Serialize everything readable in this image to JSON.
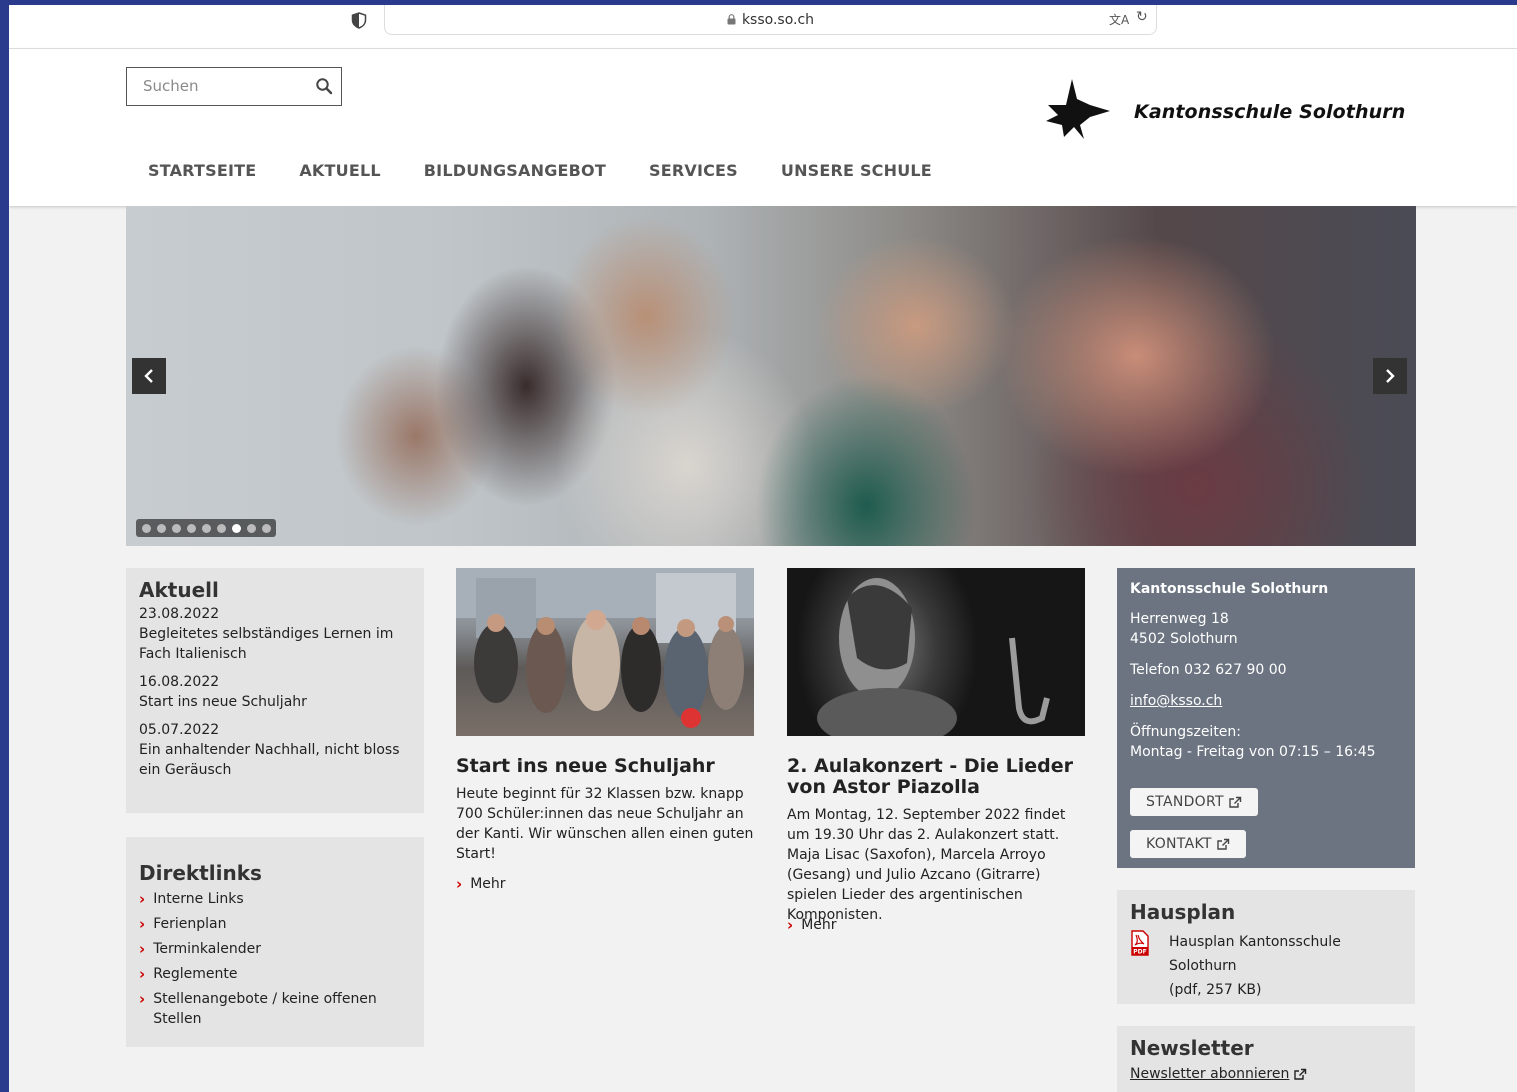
{
  "browser": {
    "url": "ksso.so.ch"
  },
  "header": {
    "search_placeholder": "Suchen",
    "school_name": "Kantonsschule Solothurn",
    "nav": [
      "STARTSEITE",
      "AKTUELL",
      "BILDUNGSANGEBOT",
      "SERVICES",
      "UNSERE SCHULE"
    ]
  },
  "hero": {
    "slide_count": 9,
    "active_slide": 6
  },
  "aktuell": {
    "title": "Aktuell",
    "items": [
      {
        "date": "23.08.2022",
        "text": "Begleitetes selbständiges Lernen im Fach Italienisch"
      },
      {
        "date": "16.08.2022",
        "text": "Start ins neue Schuljahr"
      },
      {
        "date": "05.07.2022",
        "text": "Ein anhaltender Nachhall, nicht bloss ein Geräusch"
      }
    ]
  },
  "direktlinks": {
    "title": "Direktlinks",
    "items": [
      "Interne Links",
      "Ferienplan",
      "Terminkalender",
      "Reglemente",
      "Stellenangebote / keine offenen Stellen"
    ]
  },
  "teaser1": {
    "title": "Start ins neue Schuljahr",
    "text": "Heute beginnt für 32 Klassen bzw. knapp 700 Schüler:innen das neue Schuljahr an der Kanti. Wir wünschen allen einen guten Start!",
    "more": "Mehr"
  },
  "teaser2": {
    "title": "2. Aulakonzert - Die Lieder von Astor Piazolla",
    "text": "Am Montag, 12. September 2022 findet um 19.30 Uhr das 2. Aulakonzert statt. Maja Lisac (Saxofon), Marcela Arroyo (Gesang) und Julio Azcano (Gitrarre) spielen Lieder des argentinischen Komponisten.",
    "more": "Mehr"
  },
  "contact": {
    "title": "Kantonsschule Solothurn",
    "street": "Herrenweg 18",
    "city": "4502 Solothurn",
    "phone": "Telefon 032 627 90 00",
    "email": "info@ksso.ch",
    "hours_label": "Öffnungszeiten:",
    "hours": "Montag - Freitag von 07:15 – 16:45",
    "standort": "STANDORT",
    "kontakt": "KONTAKT"
  },
  "hausplan": {
    "title": "Hausplan",
    "link": "Hausplan Kantonsschule Solothurn",
    "meta": "(pdf, 257 KB)"
  },
  "newsletter": {
    "title": "Newsletter",
    "link": "Newsletter abonnieren"
  },
  "colors": {
    "accent_red": "#cc0000",
    "contact_bg": "#6b7480",
    "box_bg": "#e4e4e4",
    "page_bg": "#f2f2f2"
  }
}
